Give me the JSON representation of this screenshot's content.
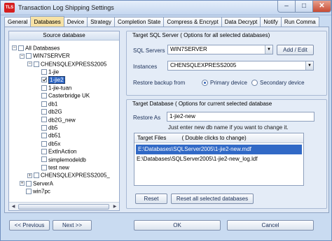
{
  "window": {
    "icon_label": "TLS",
    "title": "Transaction Log Shipping  Settings",
    "min_glyph": "–",
    "max_glyph": "□",
    "close_glyph": "✕"
  },
  "tabs": [
    "General",
    "Databases",
    "Device",
    "Strategy",
    "Completion State",
    "Compress & Encrypt",
    "Data Decrypt",
    "Notify",
    "Run Comma"
  ],
  "source_panel": {
    "title": "Source database",
    "tree": [
      {
        "label": "All Databases",
        "level": 0,
        "expander": "-",
        "checkbox": true,
        "checked": false
      },
      {
        "label": "WIN7SERVER",
        "level": 1,
        "expander": "-",
        "checkbox": true,
        "checked": false
      },
      {
        "label": "CHENSQLEXPRESS2005",
        "level": 2,
        "expander": "-",
        "checkbox": true,
        "checked": false
      },
      {
        "label": "1-jie",
        "level": 3,
        "expander": "",
        "checkbox": true,
        "checked": false
      },
      {
        "label": "1-jie2",
        "level": 3,
        "expander": "",
        "checkbox": true,
        "checked": true,
        "selected": true
      },
      {
        "label": "1-jie-tuan",
        "level": 3,
        "expander": "",
        "checkbox": true,
        "checked": false
      },
      {
        "label": "Casterbridge UK",
        "level": 3,
        "expander": "",
        "checkbox": true,
        "checked": false
      },
      {
        "label": "db1",
        "level": 3,
        "expander": "",
        "checkbox": true,
        "checked": false
      },
      {
        "label": "db2G",
        "level": 3,
        "expander": "",
        "checkbox": true,
        "checked": false
      },
      {
        "label": "db2G_new",
        "level": 3,
        "expander": "",
        "checkbox": true,
        "checked": false
      },
      {
        "label": "db5",
        "level": 3,
        "expander": "",
        "checkbox": true,
        "checked": false
      },
      {
        "label": "db51",
        "level": 3,
        "expander": "",
        "checkbox": true,
        "checked": false
      },
      {
        "label": "db5x",
        "level": 3,
        "expander": "",
        "checkbox": true,
        "checked": false
      },
      {
        "label": "ExtInAction",
        "level": 3,
        "expander": "",
        "checkbox": true,
        "checked": false
      },
      {
        "label": "simplemodeldb",
        "level": 3,
        "expander": "",
        "checkbox": true,
        "checked": false
      },
      {
        "label": "test new",
        "level": 3,
        "expander": "",
        "checkbox": true,
        "checked": false
      },
      {
        "label": "CHENSQLEXPRESS2005_",
        "level": 2,
        "expander": "+",
        "checkbox": true,
        "checked": false
      },
      {
        "label": "ServerA",
        "level": 1,
        "expander": "+",
        "checkbox": true,
        "checked": false
      },
      {
        "label": "win7pc",
        "level": 1,
        "expander": "",
        "checkbox": true,
        "checked": false
      }
    ]
  },
  "target_server": {
    "header": "Target SQL Server",
    "header_note": "( Options for all selected databases)",
    "sql_servers_label": "SQL Servers",
    "sql_servers_value": "WIN7SERVER",
    "add_edit_label": "Add / Edit",
    "instances_label": "Instances",
    "instances_value": "CHENSQLEXPRESS2005",
    "restore_from_label": "Restore backup from",
    "primary_label": "Primary device",
    "secondary_label": "Secondary device",
    "restore_from_selected": "primary"
  },
  "target_database": {
    "header": "Target Database",
    "header_note": "( Options for current selected database",
    "restore_as_label": "Restore As",
    "restore_as_value": "1-jie2-new",
    "hint": "Just enter new db name if you want to change it.",
    "files_header": "Target Files",
    "files_header_note": "( Double clicks to change)",
    "files": [
      "E:\\Databases\\SQLServer2005\\1-jie2-new.mdf",
      "E:\\Databases\\SQLServer2005\\1-jie2-new_log.ldf"
    ],
    "selected_file": 0,
    "reset_label": "Reset",
    "reset_all_label": "Reset all selected databases"
  },
  "bottom": {
    "previous_label": "<< Previous",
    "next_label": "Next >>",
    "ok_label": "OK",
    "cancel_label": "Cancel"
  },
  "colors": {
    "active_tab": "#f7e2a5",
    "selection": "#3169c6",
    "close_button": "#c64a33"
  }
}
